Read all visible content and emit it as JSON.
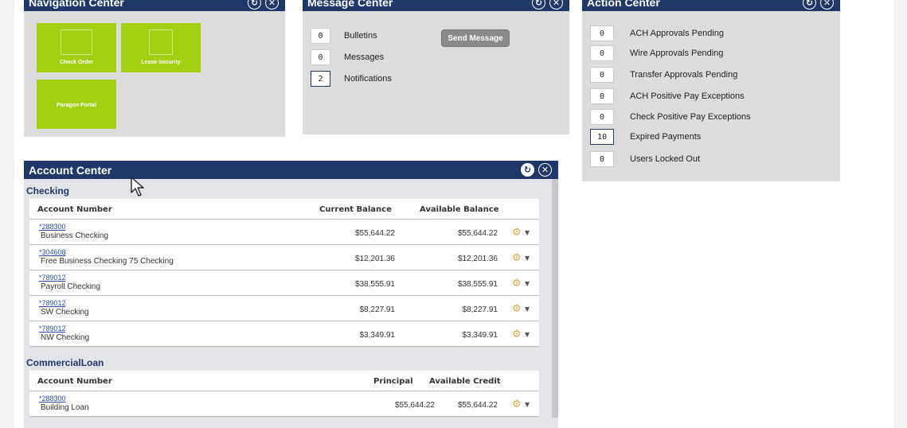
{
  "navigation_center": {
    "title": "Navigation Center",
    "tiles": [
      {
        "label": "Check Order"
      },
      {
        "label": "Lease Security"
      },
      {
        "label": "Paragon Portal"
      }
    ]
  },
  "message_center": {
    "title": "Message Center",
    "rows": [
      {
        "count": "0",
        "label": "Bulletins"
      },
      {
        "count": "0",
        "label": "Messages"
      },
      {
        "count": "2",
        "label": "Notifications"
      }
    ],
    "send_button": "Send Message"
  },
  "action_center": {
    "title": "Action Center",
    "rows": [
      {
        "count": "0",
        "label": "ACH Approvals Pending"
      },
      {
        "count": "0",
        "label": "Wire Approvals Pending"
      },
      {
        "count": "0",
        "label": "Transfer Approvals Pending"
      },
      {
        "count": "0",
        "label": "ACH Positive Pay Exceptions"
      },
      {
        "count": "0",
        "label": "Check Positive Pay Exceptions"
      },
      {
        "count": "10",
        "label": "Expired Payments"
      },
      {
        "count": "0",
        "label": "Users Locked Out"
      }
    ]
  },
  "account_center": {
    "title": "Account Center",
    "checking": {
      "title": "Checking",
      "headers": {
        "account": "Account Number",
        "current": "Current Balance",
        "available": "Available Balance"
      },
      "rows": [
        {
          "number": "*288300",
          "name": "Business Checking",
          "current": "$55,644.22",
          "available": "$55,644.22"
        },
        {
          "number": "*304608",
          "name": "Free Business Checking 75 Checking",
          "current": "$12,201.36",
          "available": "$12,201.36"
        },
        {
          "number": "*789012",
          "name": "Payroll Checking",
          "current": "$38,555.91",
          "available": "$38,555.91"
        },
        {
          "number": "*789012",
          "name": "SW Checking",
          "current": "$8,227.91",
          "available": "$8,227.91"
        },
        {
          "number": "*789012",
          "name": "NW Checking",
          "current": "$3,349.91",
          "available": "$3,349.91"
        }
      ]
    },
    "loan": {
      "title": "CommercialLoan",
      "headers": {
        "account": "Account Number",
        "principal": "Principal",
        "available": "Available Credit"
      },
      "rows": [
        {
          "number": "*288300",
          "name": "Building Loan",
          "principal": "$55,644.22",
          "available": "$55,644.22"
        }
      ]
    }
  },
  "colors": {
    "header": "#1f3769",
    "tile": "#a3cf12",
    "panel": "#dcdcdc",
    "link": "#2a4f9d"
  }
}
